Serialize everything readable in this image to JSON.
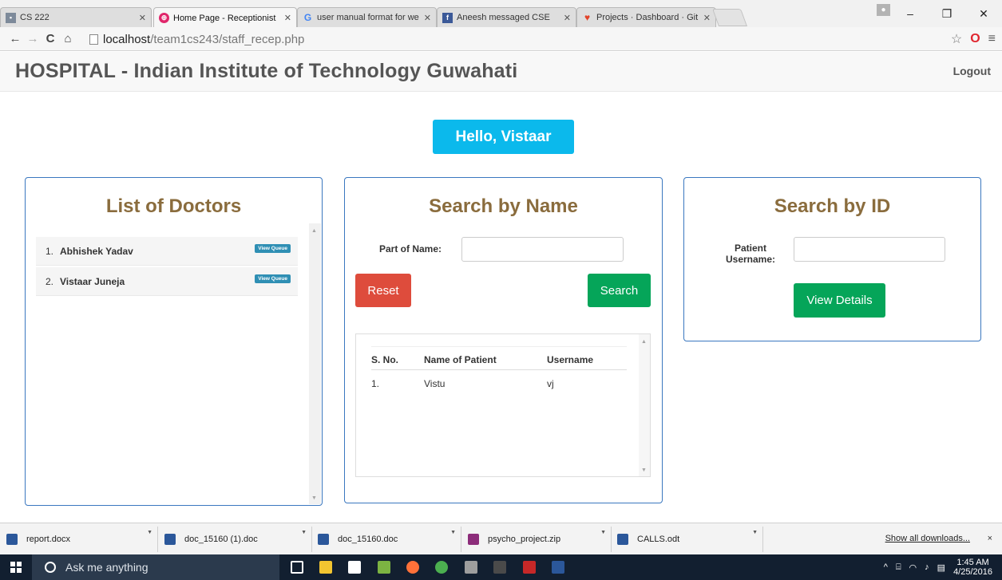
{
  "browser": {
    "tabs": [
      {
        "label": "CS 222",
        "favicon": "slide-icon"
      },
      {
        "label": "Home Page - Receptionist",
        "favicon": "hospital-icon"
      },
      {
        "label": "user manual format for we",
        "favicon": "google-icon"
      },
      {
        "label": "Aneesh messaged CSE",
        "favicon": "facebook-icon"
      },
      {
        "label": "Projects · Dashboard · Git",
        "favicon": "gitlab-icon"
      }
    ],
    "url_host": "localhost",
    "url_path": "/team1cs243/staff_recep.php"
  },
  "navbar": {
    "brand": "HOSPITAL - Indian Institute of Technology Guwahati",
    "logout": "Logout"
  },
  "greeting": "Hello, Vistaar",
  "doctors": {
    "title": "List of Doctors",
    "items": [
      {
        "index": "1.",
        "name": "Abhishek Yadav",
        "action": "View Queue"
      },
      {
        "index": "2.",
        "name": "Vistaar Juneja",
        "action": "View Queue"
      }
    ]
  },
  "search_name": {
    "title": "Search by Name",
    "label": "Part of Name:",
    "value": "",
    "reset": "Reset",
    "search": "Search",
    "columns": [
      "S. No.",
      "Name of Patient",
      "Username"
    ],
    "rows": [
      [
        "1.",
        "Vistu",
        "vj"
      ]
    ]
  },
  "search_id": {
    "title": "Search by ID",
    "label_line1": "Patient",
    "label_line2": "Username:",
    "value": "",
    "button": "View Details"
  },
  "downloads": {
    "items": [
      "report.docx",
      "doc_15160 (1).doc",
      "doc_15160.doc",
      "psycho_project.zip",
      "CALLS.odt"
    ],
    "show_all": "Show all downloads...",
    "close": "×"
  },
  "taskbar": {
    "search_placeholder": "Ask me anything",
    "time": "1:45 AM",
    "date": "4/25/2016"
  },
  "colors": {
    "accent_blue": "#0bb9ec",
    "panel_border": "#3a77bf",
    "title_brown": "#8a6c3d",
    "reset_red": "#de4c3c",
    "action_green": "#05a559"
  }
}
